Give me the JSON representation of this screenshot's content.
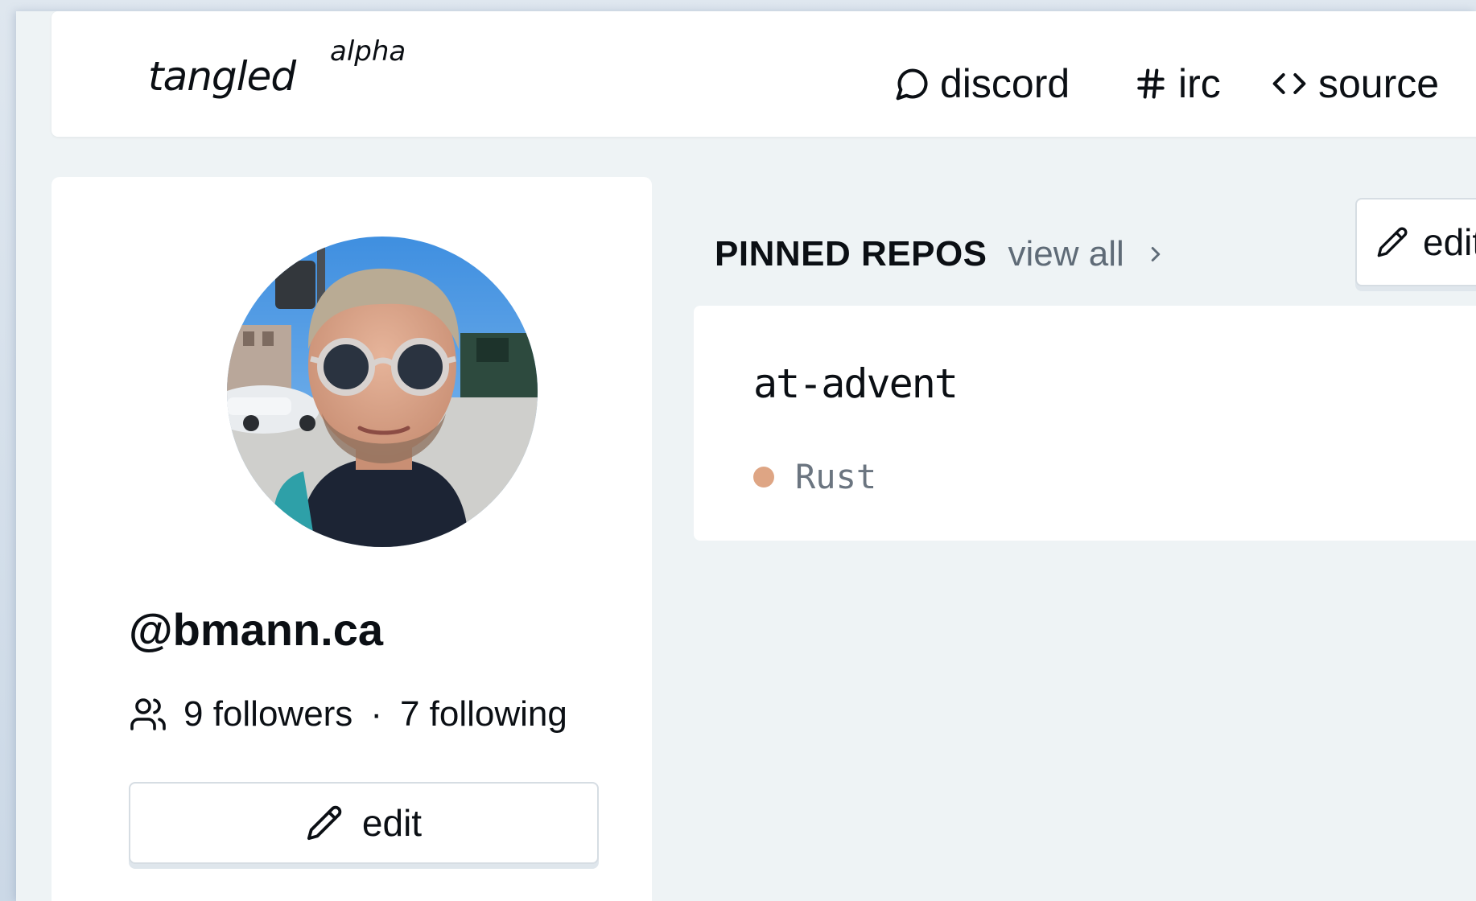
{
  "header": {
    "brand": "tangled",
    "brand_tag": "alpha",
    "nav": {
      "discord": "discord",
      "irc": "irc",
      "source": "source"
    }
  },
  "profile": {
    "handle": "@bmann.ca",
    "followers": "9 followers",
    "separator": "·",
    "following": "7 following",
    "edit_label": "edit"
  },
  "pinned": {
    "title": "PINNED REPOS",
    "view_all": "view all",
    "edit_label": "edit",
    "repos": [
      {
        "name": "at-advent",
        "language": "Rust",
        "language_color": "#dea584"
      }
    ]
  },
  "icons": {
    "discord": "message-circle-icon",
    "irc": "hash-icon",
    "source": "code-icon",
    "followers": "users-icon",
    "edit": "pencil-icon",
    "view_all": "chevron-right-icon"
  }
}
